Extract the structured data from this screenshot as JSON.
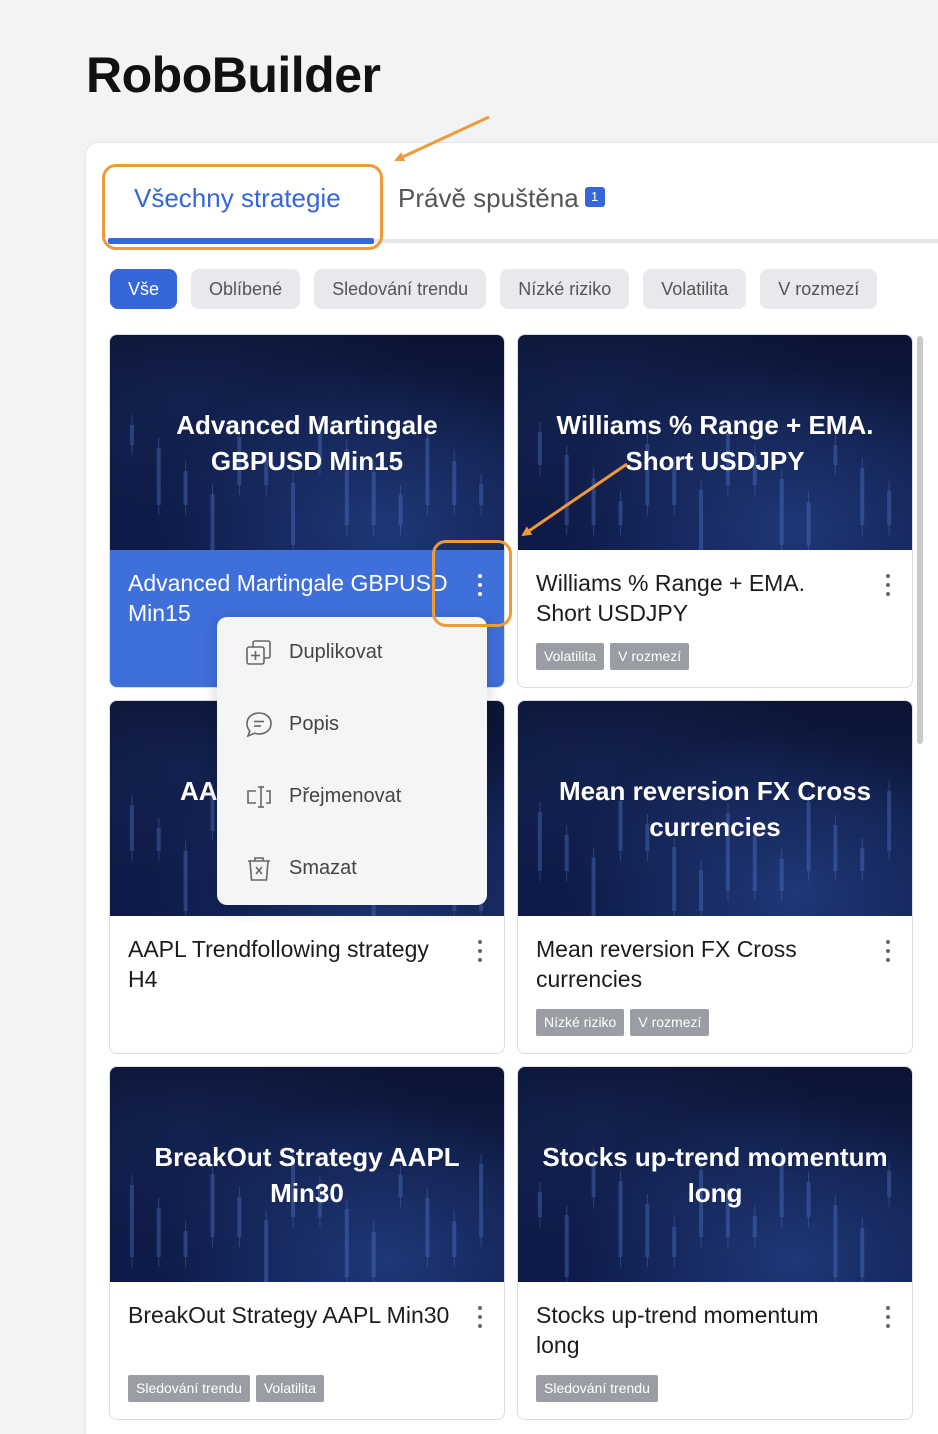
{
  "app": {
    "title": "RoboBuilder"
  },
  "tabs": [
    {
      "label": "Všechny strategie",
      "active": true
    },
    {
      "label": "Právě spuštěna",
      "badge": "1",
      "active": false
    }
  ],
  "filters": [
    "Vše",
    "Oblíbené",
    "Sledování trendu",
    "Nízké riziko",
    "Volatilita",
    "V rozmezí"
  ],
  "cards": [
    {
      "banner": "Advanced Martingale GBPUSD Min15",
      "title": "Advanced Martingale GBPUSD Min15",
      "tags": [],
      "selected": true
    },
    {
      "banner": "Williams % Range + EMA. Short USDJPY",
      "title": "Williams % Range + EMA. Short USDJPY",
      "tags": [
        "Volatilita",
        "V rozmezí"
      ]
    },
    {
      "banner": "AA",
      "title": "AAPL Trendfollowing strategy H4",
      "tags": []
    },
    {
      "banner": "Mean reversion FX Cross currencies",
      "title": "Mean reversion FX Cross currencies",
      "tags": [
        "Nízké riziko",
        "V rozmezí"
      ]
    },
    {
      "banner": "BreakOut Strategy AAPL Min30",
      "title": "BreakOut Strategy AAPL Min30",
      "tags": [
        "Sledování trendu",
        "Volatilita"
      ]
    },
    {
      "banner": "Stocks up-trend momentum long",
      "title": "Stocks up-trend momentum long",
      "tags": [
        "Sledování trendu"
      ]
    }
  ],
  "context_menu": {
    "items": [
      {
        "label": "Duplikovat",
        "icon": "duplicate-icon"
      },
      {
        "label": "Popis",
        "icon": "comment-icon"
      },
      {
        "label": "Přejmenovat",
        "icon": "rename-icon"
      },
      {
        "label": "Smazat",
        "icon": "trash-icon"
      }
    ]
  },
  "colors": {
    "accent": "#3567d8",
    "annotation": "#ef9a38",
    "banner": "#0e1a48"
  }
}
